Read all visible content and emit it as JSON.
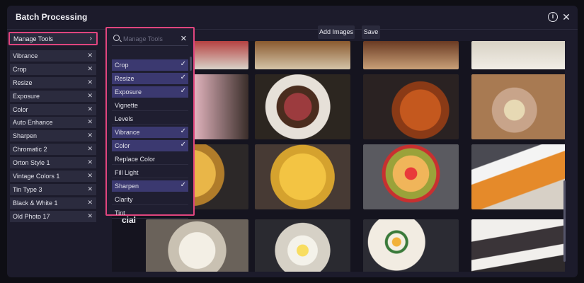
{
  "window": {
    "title": "Batch Processing"
  },
  "icons": {
    "info": "info-icon",
    "close": "close-icon",
    "search": "search-icon",
    "check": "check-icon"
  },
  "colors": {
    "accent": "#e0457e",
    "selected_row": "#3b3970",
    "panel": "#1c1b2b"
  },
  "manage_tools": {
    "label": "Manage Tools",
    "chevron": "›"
  },
  "applied_tools": [
    "Vibrance",
    "Crop",
    "Resize",
    "Exposure",
    "Color",
    "Auto Enhance",
    "Sharpen",
    "Chromatic 2",
    "Orton Style 1",
    "Vintage Colors 1",
    "Tin Type 3",
    "Black & White 1",
    "Old Photo 17"
  ],
  "dropdown": {
    "placeholder": "Manage Tools",
    "items": [
      {
        "label": "Crop",
        "selected": true
      },
      {
        "label": "Resize",
        "selected": true
      },
      {
        "label": "Exposure",
        "selected": true
      },
      {
        "label": "Vignette",
        "selected": false
      },
      {
        "label": "Levels",
        "selected": false
      },
      {
        "label": "Vibrance",
        "selected": true
      },
      {
        "label": "Color",
        "selected": true
      },
      {
        "label": "Replace Color",
        "selected": false
      },
      {
        "label": "Fill Light",
        "selected": false
      },
      {
        "label": "Sharpen",
        "selected": true
      },
      {
        "label": "Clarity",
        "selected": false
      },
      {
        "label": "Tint",
        "selected": false
      }
    ]
  },
  "toolbar": {
    "add_images": "Add Images",
    "save": "Save"
  },
  "grid_fragment_text": "cial"
}
